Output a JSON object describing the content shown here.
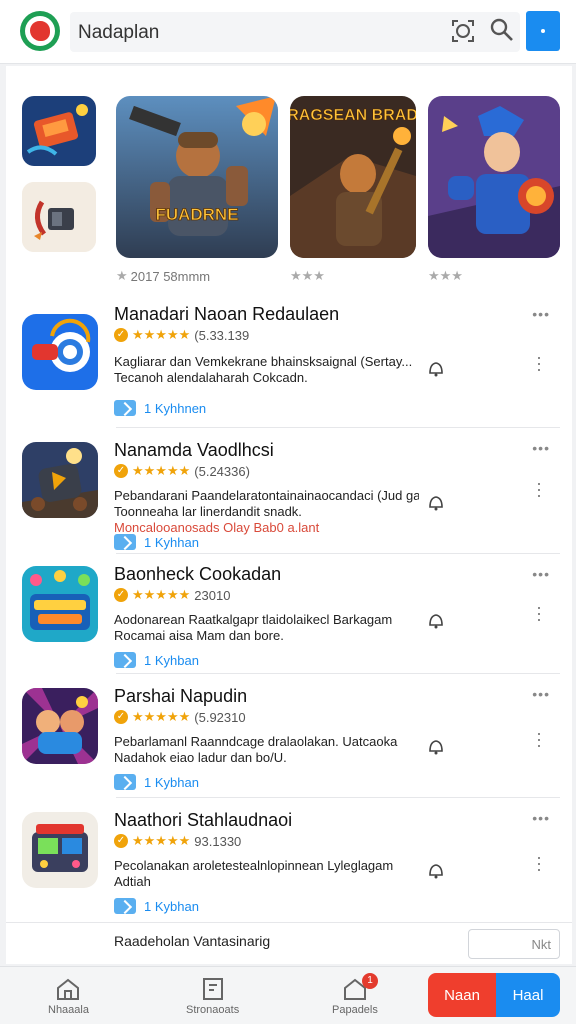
{
  "header": {
    "search_text": "Nadaplan",
    "colors": {
      "accent": "#1a8cf0",
      "logo": "#1e9f54"
    }
  },
  "featured": [
    {
      "meta": "2017 58mmm",
      "stars": "★"
    },
    {
      "meta": "",
      "stars": "★★★"
    },
    {
      "meta": "",
      "stars": "★★★"
    }
  ],
  "featured_titles": {
    "tile1": "FUADRNE",
    "tile2": "DYRAGSEAN BRADAN"
  },
  "apps": [
    {
      "title": "Manadari Naoan Redaulaen",
      "stars": "★★★★★",
      "count": "(5.33.139",
      "desc": [
        "Kagliarar dan Vemkekrane bhainsksaignal (Sertay...",
        "Tecanoh alendalaharah Cokcadn."
      ],
      "tag": "1 Kyhhnen"
    },
    {
      "title": "Nanamda Vaodlhcsi",
      "stars": "★★★★★",
      "count": "(5.24336)",
      "desc": [
        "Pebandarani Paandelaratontainainaocandaci (Jud ga...",
        "Toonneaha lar linerdandit snadk.",
        "Moncalooanosads Olay Bab0 a.lant"
      ],
      "tag": "1 Kyhhan"
    },
    {
      "title": "Baonheck Cookadan",
      "stars": "★★★★★",
      "count": "23010",
      "desc": [
        "Aodonarean Raatkalgapr tlaidolaikecl Barkagam",
        "Rocamai aisa Mam dan bore."
      ],
      "tag": "1 Kyhban"
    },
    {
      "title": "Parshai Napudin",
      "stars": "★★★★★",
      "count": "(5.92310",
      "desc": [
        "Pebarlamanl Raanndcage dralaolakan. Uatcaoka",
        "Nadahok eiao ladur dan bo/U."
      ],
      "tag": "1 Kybhan"
    },
    {
      "title": "Naathori Stahlaudnaoi",
      "stars": "★★★★★",
      "count": "93.1330",
      "desc": [
        "Pecolanakan aroletestealnlopinnean Lyleglagam",
        "Adtiah"
      ],
      "tag": "1 Kybhan"
    }
  ],
  "footer": {
    "text": "Raadeholan Vantasinarig",
    "input": "Nkt"
  },
  "bottom_nav": [
    {
      "label": "Nhaaala",
      "icon": "home-icon"
    },
    {
      "label": "Stronaoats",
      "icon": "library-icon"
    },
    {
      "label": "Papadels",
      "icon": "notifications-icon",
      "badge": "1"
    }
  ],
  "buttons": {
    "red": "Naan",
    "blue": "Haal"
  }
}
